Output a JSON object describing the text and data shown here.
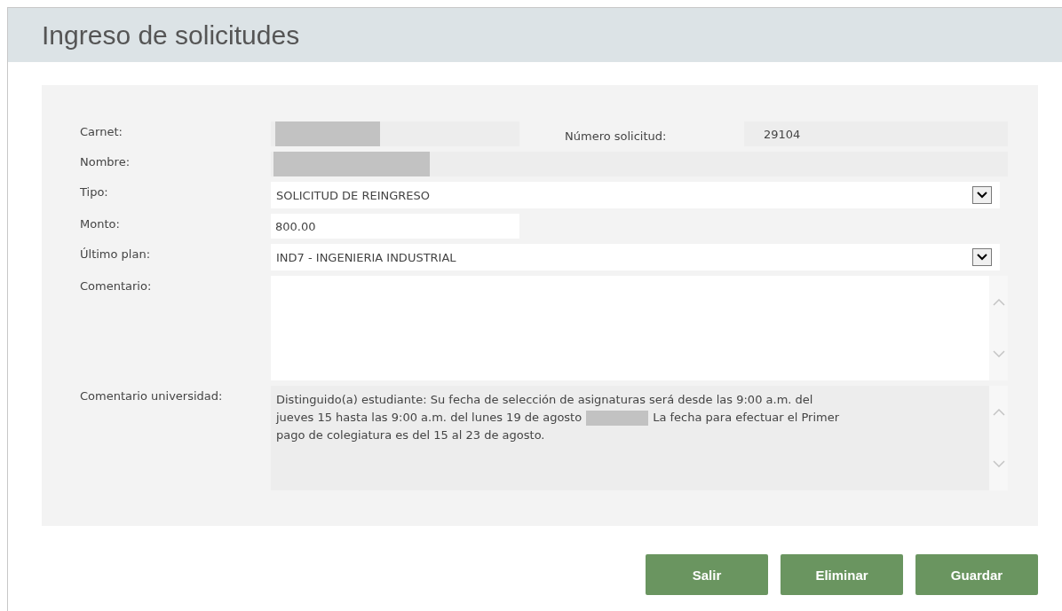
{
  "window": {
    "title": "Ingreso de solicitudes"
  },
  "form": {
    "carnet": {
      "label": "Carnet:",
      "redacted": true
    },
    "numero_solicitud": {
      "label": "Número solicitud:",
      "value": "29104"
    },
    "nombre": {
      "label": "Nombre:",
      "redacted": true
    },
    "tipo": {
      "label": "Tipo:",
      "value": "SOLICITUD DE REINGRESO"
    },
    "monto": {
      "label": "Monto:",
      "value": "800.00"
    },
    "ultimo_plan": {
      "label": "Último plan:",
      "value": "IND7 - INGENIERIA INDUSTRIAL"
    },
    "comentario": {
      "label": "Comentario:"
    },
    "comentario_universidad": {
      "label": "Comentario universidad:",
      "line_1": "Distinguido(a) estudiante: Su fecha de selección de asignaturas será desde las 9:00 a.m. del",
      "line_2_before": "jueves 15 hasta las 9:00 a.m. del lunes 19 de agosto",
      "redacted": true,
      "line_2_after": "La fecha para efectuar el Primer",
      "line_3": "pago de colegiatura es del 15 al 23 de agosto."
    }
  },
  "buttons": [
    {
      "label": "Salir"
    },
    {
      "label": "Eliminar"
    },
    {
      "label": "Guardar"
    }
  ]
}
